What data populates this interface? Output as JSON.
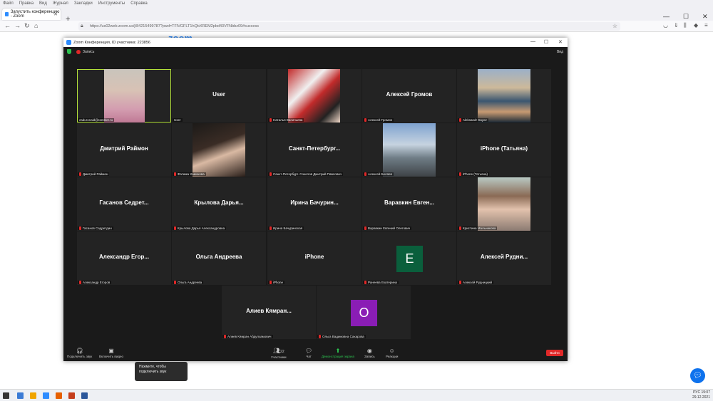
{
  "browser": {
    "menu": [
      "Файл",
      "Правка",
      "Вид",
      "Журнал",
      "Закладки",
      "Инструменты",
      "Справка"
    ],
    "tab_title": "Запустить конференцию - Zoom",
    "url": "https://us02web.zoom.us/j/84215499787?pwd=TFlVGFLT1hQbXREM2pbd43VFNbbz09#success",
    "logo": "zoom"
  },
  "zoom": {
    "title": "Zoom Конференция, ID участника: 223856",
    "record_label": "Запись",
    "view_label": "Вид",
    "tiles": [
      {
        "name": "",
        "label": "zaduronald@rambler.ru",
        "photo": "woman-blonde",
        "active": true
      },
      {
        "name": "User",
        "label": "User"
      },
      {
        "name": "",
        "label": "Наталья Васильева",
        "photo": "woman-red-wall"
      },
      {
        "name": "Алексей Громов",
        "label": "Алексей Громов"
      },
      {
        "name": "",
        "label": "Aleksandr Sayov",
        "photo": "man-sea"
      },
      {
        "name": "Дмитрий Раймон",
        "label": "Дмитрий Раймон"
      },
      {
        "name": "",
        "label": "Фатима Хамокова",
        "photo": "woman-dark-hair"
      },
      {
        "name": "Санкт-Петербург...",
        "label": "Санкт-Петербург. Соколов Дмитрий Павлович"
      },
      {
        "name": "",
        "label": "Алексей Беляев",
        "photo": "man-church"
      },
      {
        "name": "iPhone (Татьяна)",
        "label": "iPhone (Татьяна)"
      },
      {
        "name": "Гасанов Седрет...",
        "label": "Гасанов Седретдин"
      },
      {
        "name": "Крылова Дарья...",
        "label": "Крылова Дарья Александровна"
      },
      {
        "name": "Ирина Бачурин...",
        "label": "Ирина Бачуринская"
      },
      {
        "name": "Варавкин Евген...",
        "label": "Варавкин Евгений Олегович"
      },
      {
        "name": "",
        "label": "Кристина Мальникова",
        "photo": "woman-smile"
      },
      {
        "name": "Александр Егор...",
        "label": "Александр Егоров"
      },
      {
        "name": "Ольга Андреева",
        "label": "Ольга Андреева"
      },
      {
        "name": "iPhone",
        "label": "iPhone"
      },
      {
        "name": "",
        "label": "Ранеева Екатерина",
        "avatar": "E",
        "avatar_color": "#0a5f3c"
      },
      {
        "name": "Алексей Рудни...",
        "label": "Алексей Рудницкий"
      },
      {
        "name": "Алиев Кямран...",
        "label": "Алиев Кямран Абдулхамович"
      },
      {
        "name": "",
        "label": "Ольга Вадимовна Сахарова",
        "avatar": "O",
        "avatar_color": "#8a1db5"
      }
    ],
    "tooltip": "Нажмите, чтобы подключить звук",
    "toolbar": {
      "audio": "Подключить звук",
      "video": "Включить видео",
      "participants": "Участники",
      "participants_count": "22",
      "chat": "Чат",
      "share": "Демонстрация экрана",
      "record": "Запись",
      "reactions": "Реакции",
      "end": "Выйти"
    }
  },
  "taskbar": {
    "lang": "РУС",
    "time": "19:07",
    "date": "29.12.2021"
  }
}
